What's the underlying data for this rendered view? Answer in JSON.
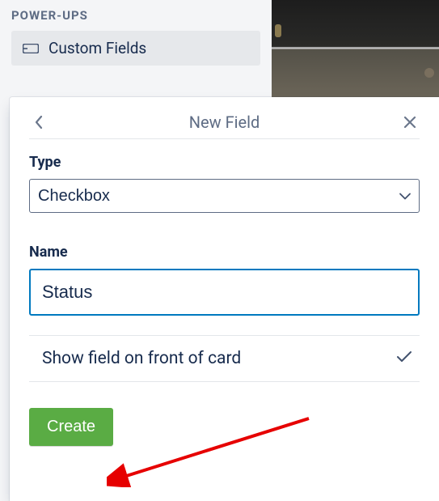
{
  "sidebar": {
    "section_title": "POWER-UPS",
    "item_label": "Custom Fields"
  },
  "dialog": {
    "title": "New Field",
    "type": {
      "label": "Type",
      "value": "Checkbox"
    },
    "name": {
      "label": "Name",
      "value": "Status"
    },
    "show_on_front": {
      "label": "Show field on front of card",
      "checked": true
    },
    "create_button": "Create"
  }
}
